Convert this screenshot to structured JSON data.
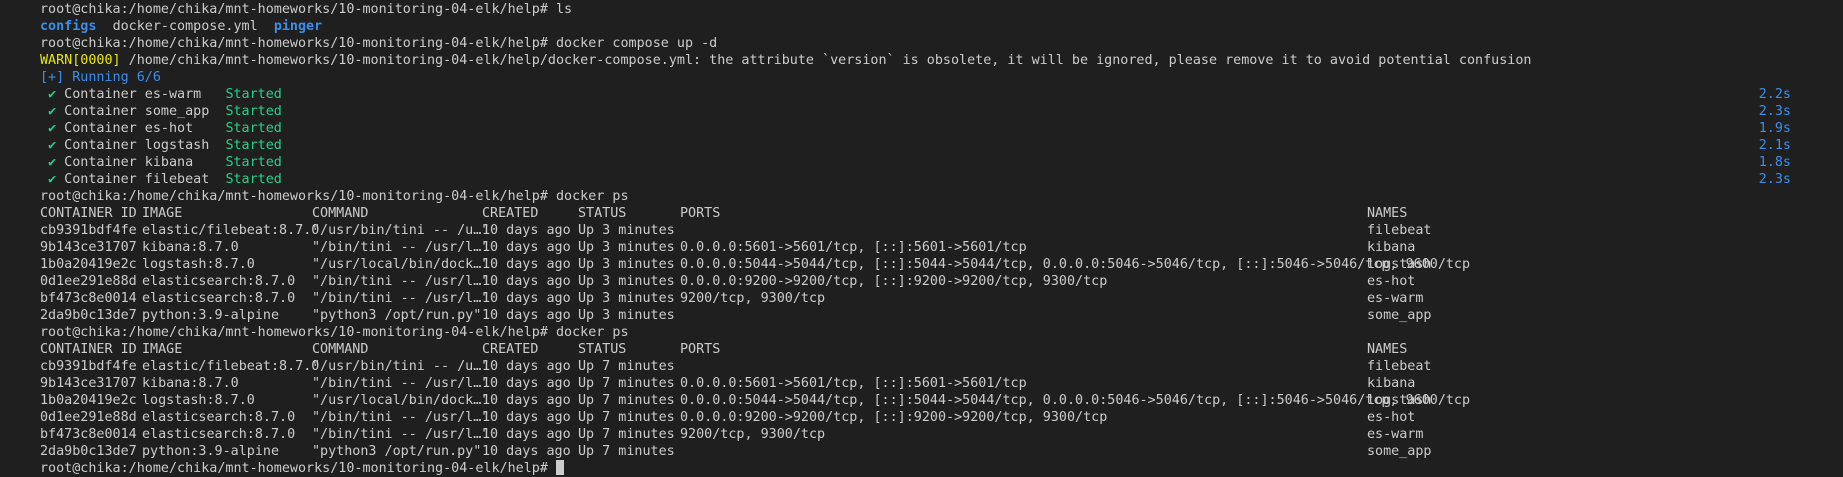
{
  "colors": {
    "background": "#1f1f1f",
    "text": "#cccccc",
    "dir": "#3b8eea",
    "started": "#23d18b",
    "warn": "#e5e510",
    "running": "#3b8eea"
  },
  "prompt": "root@chika:/home/chika/mnt-homeworks/10-monitoring-04-elk/help#",
  "cmd_ls": " ls",
  "ls_output": {
    "dir1": "configs",
    "file1": "docker-compose.yml",
    "dir2": "pinger"
  },
  "cmd_up": " docker compose up -d",
  "warn": {
    "tag": "WARN[0000]",
    "text": " /home/chika/mnt-homeworks/10-monitoring-04-elk/help/docker-compose.yml: the attribute `version` is obsolete, it will be ignored, please remove it to avoid potential confusion"
  },
  "running": "[+] Running 6/6",
  "containers_started": [
    {
      "prefix": " ✔ Container es-warm   ",
      "status": "Started",
      "time": "2.2s"
    },
    {
      "prefix": " ✔ Container some_app  ",
      "status": "Started",
      "time": "2.3s"
    },
    {
      "prefix": " ✔ Container es-hot    ",
      "status": "Started",
      "time": "1.9s"
    },
    {
      "prefix": " ✔ Container logstash  ",
      "status": "Started",
      "time": "2.1s"
    },
    {
      "prefix": " ✔ Container kibana    ",
      "status": "Started",
      "time": "1.8s"
    },
    {
      "prefix": " ✔ Container filebeat  ",
      "status": "Started",
      "time": "2.3s"
    }
  ],
  "cmd_ps": " docker ps",
  "ps_headers": [
    "CONTAINER ID",
    "IMAGE",
    "COMMAND",
    "CREATED",
    "STATUS",
    "PORTS",
    "NAMES"
  ],
  "ps_table_1": [
    [
      "cb9391bdf4fe",
      "elastic/filebeat:8.7.0",
      "\"/usr/bin/tini -- /u…\"",
      "10 days ago",
      "Up 3 minutes",
      "",
      "filebeat"
    ],
    [
      "9b143ce31707",
      "kibana:8.7.0",
      "\"/bin/tini -- /usr/l…\"",
      "10 days ago",
      "Up 3 minutes",
      "0.0.0.0:5601->5601/tcp, [::]:5601->5601/tcp",
      "kibana"
    ],
    [
      "1b0a20419e2c",
      "logstash:8.7.0",
      "\"/usr/local/bin/dock…\"",
      "10 days ago",
      "Up 3 minutes",
      "0.0.0.0:5044->5044/tcp, [::]:5044->5044/tcp, 0.0.0.0:5046->5046/tcp, [::]:5046->5046/tcp, 9600/tcp",
      "logstash"
    ],
    [
      "0d1ee291e88d",
      "elasticsearch:8.7.0",
      "\"/bin/tini -- /usr/l…\"",
      "10 days ago",
      "Up 3 minutes",
      "0.0.0.0:9200->9200/tcp, [::]:9200->9200/tcp, 9300/tcp",
      "es-hot"
    ],
    [
      "bf473c8e0014",
      "elasticsearch:8.7.0",
      "\"/bin/tini -- /usr/l…\"",
      "10 days ago",
      "Up 3 minutes",
      "9200/tcp, 9300/tcp",
      "es-warm"
    ],
    [
      "2da9b0c13de7",
      "python:3.9-alpine",
      "\"python3 /opt/run.py\"",
      "10 days ago",
      "Up 3 minutes",
      "",
      "some_app"
    ]
  ],
  "ps_table_2": [
    [
      "cb9391bdf4fe",
      "elastic/filebeat:8.7.0",
      "\"/usr/bin/tini -- /u…\"",
      "10 days ago",
      "Up 7 minutes",
      "",
      "filebeat"
    ],
    [
      "9b143ce31707",
      "kibana:8.7.0",
      "\"/bin/tini -- /usr/l…\"",
      "10 days ago",
      "Up 7 minutes",
      "0.0.0.0:5601->5601/tcp, [::]:5601->5601/tcp",
      "kibana"
    ],
    [
      "1b0a20419e2c",
      "logstash:8.7.0",
      "\"/usr/local/bin/dock…\"",
      "10 days ago",
      "Up 7 minutes",
      "0.0.0.0:5044->5044/tcp, [::]:5044->5044/tcp, 0.0.0.0:5046->5046/tcp, [::]:5046->5046/tcp, 9600/tcp",
      "logstash"
    ],
    [
      "0d1ee291e88d",
      "elasticsearch:8.7.0",
      "\"/bin/tini -- /usr/l…\"",
      "10 days ago",
      "Up 7 minutes",
      "0.0.0.0:9200->9200/tcp, [::]:9200->9200/tcp, 9300/tcp",
      "es-hot"
    ],
    [
      "bf473c8e0014",
      "elasticsearch:8.7.0",
      "\"/bin/tini -- /usr/l…\"",
      "10 days ago",
      "Up 7 minutes",
      "9200/tcp, 9300/tcp",
      "es-warm"
    ],
    [
      "2da9b0c13de7",
      "python:3.9-alpine",
      "\"python3 /opt/run.py\"",
      "10 days ago",
      "Up 7 minutes",
      "",
      "some_app"
    ]
  ]
}
